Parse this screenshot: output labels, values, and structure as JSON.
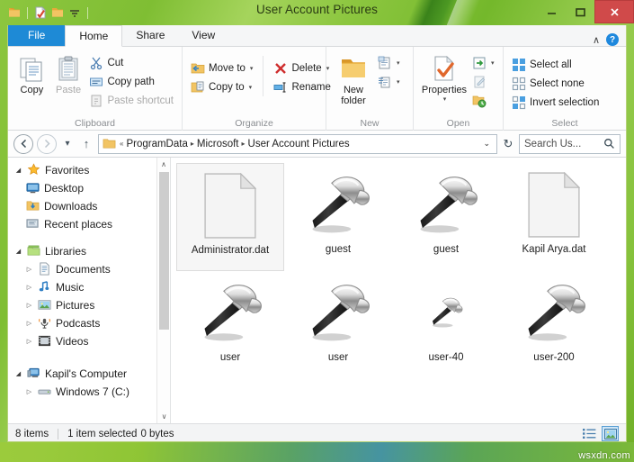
{
  "window": {
    "title": "User Account Pictures",
    "minimize": "–",
    "maximize": "☐",
    "close": "✕",
    "accent_green": "#8dc63f",
    "close_red": "#d04a4a"
  },
  "quick_access": {
    "items": [
      {
        "name": "folder-icon",
        "label": "Folder"
      },
      {
        "name": "properties-icon",
        "label": "Properties"
      },
      {
        "name": "new-folder-icon",
        "label": "New folder"
      },
      {
        "name": "customize-dropdown-icon",
        "label": "Customize Quick Access Toolbar"
      }
    ]
  },
  "ribbon": {
    "tabs": [
      {
        "id": "file",
        "label": "File"
      },
      {
        "id": "home",
        "label": "Home"
      },
      {
        "id": "share",
        "label": "Share"
      },
      {
        "id": "view",
        "label": "View"
      }
    ],
    "active_tab": "Home",
    "collapse_label": "∧",
    "help_label": "?",
    "groups": [
      {
        "title": "Clipboard",
        "big": [
          {
            "label": "Copy",
            "icon": "copy-icon",
            "disabled": false
          },
          {
            "label": "Paste",
            "icon": "paste-icon",
            "disabled": true
          }
        ],
        "small": [
          {
            "label": "Cut",
            "icon": "scissors-icon",
            "disabled": false
          },
          {
            "label": "Copy path",
            "icon": "copy-path-icon",
            "disabled": false
          },
          {
            "label": "Paste shortcut",
            "icon": "paste-shortcut-icon",
            "disabled": true
          }
        ]
      },
      {
        "title": "Organize",
        "small": [
          {
            "label": "Move to",
            "icon": "move-to-icon",
            "caret": "▾"
          },
          {
            "label": "Copy to",
            "icon": "copy-to-icon",
            "caret": "▾"
          }
        ],
        "small2": [
          {
            "label": "Delete",
            "icon": "delete-x-icon",
            "caret": "▾"
          },
          {
            "label": "Rename",
            "icon": "rename-icon",
            "caret": ""
          }
        ]
      },
      {
        "title": "New",
        "big": [
          {
            "label": "New\nfolder",
            "label_line1": "New",
            "label_line2": "folder",
            "icon": "new-folder-icon"
          }
        ],
        "small": [
          {
            "label": "",
            "icon": "new-item-icon",
            "caret": "▾"
          },
          {
            "label": "",
            "icon": "easy-access-icon",
            "caret": "▾"
          }
        ]
      },
      {
        "title": "Open",
        "big": [
          {
            "label": "Properties",
            "icon": "properties-icon",
            "caret": "▾"
          }
        ],
        "small": [
          {
            "label": "",
            "icon": "open-icon",
            "caret": "▾"
          },
          {
            "label": "",
            "icon": "edit-icon",
            "caret": "",
            "disabled": true
          },
          {
            "label": "",
            "icon": "history-icon",
            "caret": ""
          }
        ]
      },
      {
        "title": "Select",
        "small": [
          {
            "label": "Select all",
            "icon": "select-all-icon"
          },
          {
            "label": "Select none",
            "icon": "select-none-icon"
          },
          {
            "label": "Invert selection",
            "icon": "invert-selection-icon"
          }
        ]
      }
    ]
  },
  "addressbar": {
    "back": "←",
    "forward": "→",
    "recent_caret": "▾",
    "up": "↑",
    "folder_icon": "folder-icon",
    "prefix": "«",
    "crumbs": [
      "ProgramData",
      "Microsoft",
      "User Account Pictures"
    ],
    "separator": "▸",
    "dropdown": "⌄",
    "refresh": "↻",
    "search_placeholder": "Search Us...",
    "search_value": ""
  },
  "navigation": {
    "groups": [
      {
        "header": {
          "label": "Favorites",
          "icon": "star-icon",
          "twisty": "◢"
        },
        "items": [
          {
            "label": "Desktop",
            "icon": "desktop-icon",
            "twisty": ""
          },
          {
            "label": "Downloads",
            "icon": "downloads-icon",
            "twisty": ""
          },
          {
            "label": "Recent places",
            "icon": "recent-places-icon",
            "twisty": ""
          }
        ]
      },
      {
        "header": {
          "label": "Libraries",
          "icon": "libraries-icon",
          "twisty": "◢"
        },
        "items": [
          {
            "label": "Documents",
            "icon": "documents-icon",
            "twisty": "▷"
          },
          {
            "label": "Music",
            "icon": "music-icon",
            "twisty": "▷"
          },
          {
            "label": "Pictures",
            "icon": "pictures-icon",
            "twisty": "▷"
          },
          {
            "label": "Podcasts",
            "icon": "podcasts-icon",
            "twisty": "▷"
          },
          {
            "label": "Videos",
            "icon": "videos-icon",
            "twisty": "▷"
          }
        ]
      },
      {
        "header": {
          "label": "Kapil's Computer",
          "icon": "computer-icon",
          "twisty": "◢"
        },
        "items": [
          {
            "label": "Windows 7 (C:)",
            "icon": "drive-icon",
            "twisty": "▷"
          }
        ]
      }
    ],
    "scroll_up": "∧",
    "scroll_down": "∨"
  },
  "files": [
    {
      "name": "Administrator.dat",
      "icon": "blank-document-icon",
      "selected": true,
      "size": "large"
    },
    {
      "name": "guest",
      "icon": "hammer-icon",
      "selected": false,
      "size": "large"
    },
    {
      "name": "guest",
      "icon": "hammer-icon",
      "selected": false,
      "size": "large"
    },
    {
      "name": "Kapil Arya.dat",
      "icon": "blank-document-icon",
      "selected": false,
      "size": "large"
    },
    {
      "name": "user",
      "icon": "hammer-icon",
      "selected": false,
      "size": "large"
    },
    {
      "name": "user",
      "icon": "hammer-icon",
      "selected": false,
      "size": "large"
    },
    {
      "name": "user-40",
      "icon": "hammer-icon",
      "selected": false,
      "size": "small"
    },
    {
      "name": "user-200",
      "icon": "hammer-icon",
      "selected": false,
      "size": "large"
    }
  ],
  "statusbar": {
    "item_count": "8 items",
    "selection": "1 item selected",
    "selection_size": "0 bytes",
    "views": [
      {
        "name": "details-view-button",
        "active": false
      },
      {
        "name": "large-icons-view-button",
        "active": true
      }
    ]
  },
  "watermark": "wsxdn.com"
}
